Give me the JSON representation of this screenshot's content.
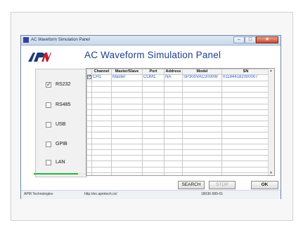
{
  "window": {
    "title": "AC Waveform Simulation Panel",
    "controls": {
      "minimize": "–",
      "maximize": "□",
      "close": "✕"
    }
  },
  "header": {
    "logo_text": "APM",
    "title": "AC Waveform Simulation Panel",
    "title_color": "#1f3f8a"
  },
  "interfaces": [
    {
      "label": "RS232",
      "checked": true
    },
    {
      "label": "RS485",
      "checked": false
    },
    {
      "label": "USB",
      "checked": false
    },
    {
      "label": "GPIB",
      "checked": false
    },
    {
      "label": "LAN",
      "checked": false
    }
  ],
  "progress": {
    "fraction": 0.85,
    "color": "#25b43a"
  },
  "table": {
    "columns": [
      "",
      "Channel",
      "Master/Slave",
      "Port",
      "Address",
      "Model",
      "SN"
    ],
    "rows": [
      [
        "✓",
        "CH1",
        "Master",
        "COM1",
        "NA",
        "SP300VAC2000W",
        "011844182000007"
      ]
    ],
    "empty_rows": 20,
    "text_color": "#2b5fc7"
  },
  "buttons": {
    "search": "SEARCH",
    "stop": "STOP",
    "ok": "OK"
  },
  "status": {
    "company": "APM Technologies",
    "url": "http://en.apmtech.cn/",
    "code": "18036-589-01"
  },
  "icons": [
    "app-icon",
    "apm-logo",
    "checkbox-icon",
    "scroll-up-icon",
    "scroll-down-icon"
  ]
}
